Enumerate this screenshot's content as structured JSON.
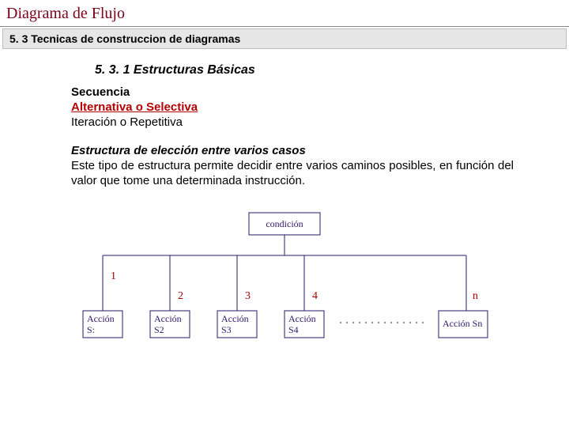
{
  "page": {
    "title": "Diagrama de Flujo",
    "section_bar": "5. 3 Tecnicas de construccion de diagramas",
    "sub_heading": "5. 3. 1 Estructuras Básicas"
  },
  "structures": {
    "sequence": "Secuencia",
    "alternative": "Alternativa o Selectiva",
    "iteration": "Iteración o Repetitiva"
  },
  "selection": {
    "title": "Estructura de elección entre varios casos",
    "body": "Este tipo de estructura permite decidir entre varios caminos posibles, en función del valor que tome una determinada instrucción."
  },
  "diagram": {
    "condition": "condición",
    "branches": [
      "1",
      "2",
      "3",
      "4",
      "n"
    ],
    "actions": [
      {
        "l1": "Acción",
        "l2": "S:"
      },
      {
        "l1": "Acción",
        "l2": "S2"
      },
      {
        "l1": "Acción",
        "l2": "S3"
      },
      {
        "l1": "Acción",
        "l2": "S4"
      },
      {
        "l1": "Acción Sn",
        "l2": ""
      }
    ]
  }
}
